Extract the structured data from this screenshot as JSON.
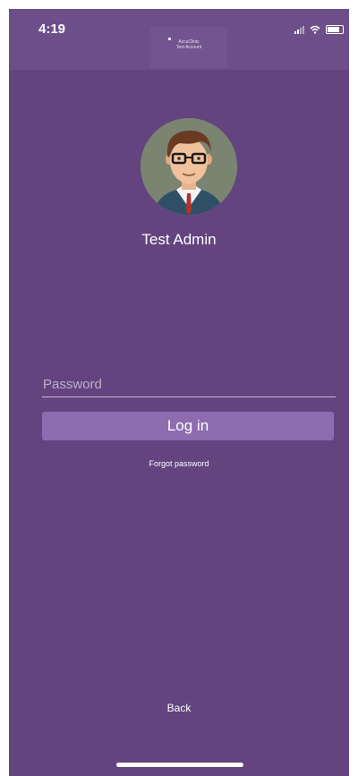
{
  "status_bar": {
    "time": "4:19",
    "icons": [
      "signal-icon",
      "wifi-icon",
      "battery-icon"
    ]
  },
  "header": {
    "logo_line1": "AccuClinic",
    "logo_line2": "Test Account"
  },
  "profile": {
    "avatar": "avatar-cartoon-man-glasses",
    "name": "Test Admin"
  },
  "login": {
    "password_placeholder": "Password",
    "password_value": "",
    "login_label": "Log in",
    "forgot_label": "Forgot password"
  },
  "footer": {
    "back_label": "Back"
  },
  "colors": {
    "background": "#63447f",
    "button": "#8d6db0",
    "text": "#ffffff"
  }
}
